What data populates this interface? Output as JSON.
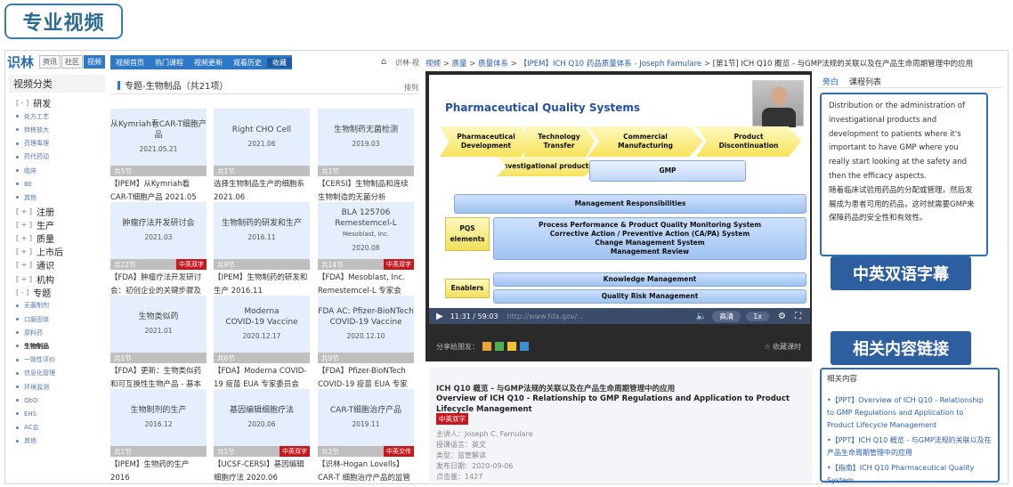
{
  "banner": "专业视频",
  "topbar": {
    "logo": "识林",
    "mini_tabs": [
      "资讯",
      "社区",
      "视频"
    ],
    "nav": [
      "视频首页",
      "热门课程",
      "视频更新",
      "观看历史",
      "收藏"
    ],
    "home_text": "识林-视"
  },
  "sidebar": {
    "title": "视频分类",
    "items": [
      {
        "kind": "main",
        "pm": "[ - ]",
        "label": "研发"
      },
      {
        "kind": "sub",
        "label": "处方工艺"
      },
      {
        "kind": "sub",
        "label": "转移放大"
      },
      {
        "kind": "sub",
        "label": "药理毒理"
      },
      {
        "kind": "sub",
        "label": "药代药动"
      },
      {
        "kind": "sub",
        "label": "临床"
      },
      {
        "kind": "sub",
        "label": "BE"
      },
      {
        "kind": "sub",
        "label": "其他"
      },
      {
        "kind": "main",
        "pm": "[ + ]",
        "label": "注册"
      },
      {
        "kind": "main",
        "pm": "[ + ]",
        "label": "生产"
      },
      {
        "kind": "main",
        "pm": "[ + ]",
        "label": "质量"
      },
      {
        "kind": "main",
        "pm": "[ + ]",
        "label": "上市后"
      },
      {
        "kind": "main",
        "pm": "[ + ]",
        "label": "通识"
      },
      {
        "kind": "main",
        "pm": "[ + ]",
        "label": "机构"
      },
      {
        "kind": "main",
        "pm": "[ - ]",
        "label": "专题"
      },
      {
        "kind": "sub",
        "label": "无菌制剂"
      },
      {
        "kind": "sub",
        "label": "口服固体"
      },
      {
        "kind": "sub",
        "label": "原料药"
      },
      {
        "kind": "sub",
        "label": "生物制品",
        "current": true
      },
      {
        "kind": "sub",
        "label": "一致性评价"
      },
      {
        "kind": "sub",
        "label": "信息化管理"
      },
      {
        "kind": "sub",
        "label": "环境监测"
      },
      {
        "kind": "sub",
        "label": "QbD"
      },
      {
        "kind": "sub",
        "label": "EHS"
      },
      {
        "kind": "sub",
        "label": "AC会"
      },
      {
        "kind": "sub",
        "label": "其他"
      }
    ]
  },
  "content": {
    "title": "专题-生物制品（共21项）",
    "sort": "排列"
  },
  "cards": [
    {
      "lines": [
        "从Kymriah看CAR-T细胞产品"
      ],
      "date": "2021.05.21",
      "count": "共5节",
      "tag": "",
      "desc": "【IPEM】从Kymriah看CAR-T细胞产品 2021.05"
    },
    {
      "lines": [
        "Right CHO Cell"
      ],
      "date": "2021.06",
      "count": "共1节",
      "tag": "",
      "desc": "选择生物制品生产的细胞系 2021.06"
    },
    {
      "lines": [
        "生物制药无菌检测"
      ],
      "date": "2019.03",
      "count": "共1节",
      "tag": "",
      "desc": "【CERSI】生物制品和连续生物制造的无菌分析 2019.03"
    },
    {
      "lines": [
        "肿瘤疗法开发研讨会"
      ],
      "date": "2021.03",
      "count": "共22节",
      "tag": "中英双字",
      "desc": "【FDA】肿瘤疗法开发研讨会：初创企业的关键步骤及"
    },
    {
      "lines": [
        "生物制药的研发和生产"
      ],
      "date": "2016.11",
      "count": "共9节",
      "tag": "",
      "desc": "【IPEM】生物制药的研发和生产 2016.11"
    },
    {
      "lines": [
        "BLA 125706",
        "Remestemcel-L"
      ],
      "small": "Mesoblast, Inc.",
      "date": "2020.08",
      "count": "共14节",
      "tag": "中英双字",
      "desc": "【FDA】Mesoblast, Inc. Remestemcel-L 专家会"
    },
    {
      "lines": [
        "生物类似药"
      ],
      "date": "2021.01",
      "count": "共1节",
      "tag": "",
      "desc": "【FDA】更新：生物类似药和可互换性生物产品 - 基本"
    },
    {
      "lines": [
        "Moderna",
        "COVID-19 Vaccine"
      ],
      "date": "2020.12.17",
      "count": "共6节",
      "tag": "",
      "desc": "【FDA】Moderna COVID-19 疫苗 EUA 专家委员会"
    },
    {
      "lines": [
        "FDA AC: Pfizer-BioNTech",
        "COVID-19 Vaccine"
      ],
      "date": "2020.12.10",
      "count": "共9节",
      "tag": "",
      "desc": "【FDA】Pfizer-BioNTech COVID-19 疫苗 EUA 专家委"
    },
    {
      "lines": [
        "生物制剂的生产"
      ],
      "date": "2016.12",
      "count": "共1节",
      "tag": "",
      "desc": "【IPEM】生物药的生产 2016"
    },
    {
      "lines": [
        "基因编辑细胞疗法"
      ],
      "date": "2020.06",
      "count": "共1节",
      "tag": "中英双字",
      "desc": "【UCSF-CERSI】基因编辑细胞疗法 2020.06"
    },
    {
      "lines": [
        "CAR-T细胞治疗产品"
      ],
      "date": "2019.11",
      "count": "共2节",
      "tag": "中英交传",
      "desc": "【识林-Hogan Lovells】CAR-T 细胞治疗产品的监管"
    }
  ],
  "breadcrumb": [
    "视频",
    "质量",
    "质量体系",
    "【IPEM】ICH Q10 药品质量体系 - Joseph Famulare",
    "[第1节] ICH Q10 概览 - 与GMP法规的关联以及在产品生命周期管理中的应用"
  ],
  "slide": {
    "title": "Pharmaceutical Quality Systems",
    "chevrons": [
      "Pharmaceutical\nDevelopment",
      "Technology\nTransfer",
      "Commercial\nManufacturing",
      "Product\nDiscontinuation"
    ],
    "investigational": "Investigational products",
    "gmp": "GMP",
    "mgmt_resp": "Management Responsibilities",
    "pqs_label": "PQS\nelements",
    "pqs_lines": "Process Performance & Product Quality Monitoring System\nCorrective Action / Preventive Action (CA/PA) System\nChange Management System\nManagement Review",
    "enablers": "Enablers",
    "knowledge": "Knowledge Management",
    "qrm": "Quality Risk Management"
  },
  "player": {
    "time": "11:31 / 59:03",
    "url": "http://www.fda.gov/...",
    "quality": "高清",
    "speed": "1x"
  },
  "share": {
    "label": "分享给朋友：",
    "fav": "收藏课时"
  },
  "side_tabs": [
    "旁白",
    "课程列表"
  ],
  "transcript": {
    "en": "Distribution or the administration of investigational products and development to patients where it's important to have GMP where you really start looking at the safety and then the efficacy aspects.",
    "zh": "随着临床试验用药品的分配或管理，然后发展成为患者可用的药品，这时就需要GMP来保障药品的安全性和有效性。"
  },
  "callouts": {
    "subtitle": "中英双语字幕",
    "links": "相关内容链接"
  },
  "detail": {
    "title_cn": "ICH Q10 概览 - 与GMP法规的关联以及在产品生命周期管理中的应用",
    "title_en": "Overview of ICH Q10 - Relationship to GMP Regulations and Application to Product Lifecycle Management",
    "tag": "中英双字",
    "speaker": "主讲人：Joseph C. Famulare",
    "lang": "授课语言：英文",
    "type": "类型：监管解读",
    "date": "发布日期：2020-09-06",
    "clicks": "点击量：1427"
  },
  "related": {
    "header": "相关内容",
    "items": [
      "•【PPT】Overview of ICH Q10 - Relationship to GMP Regulations and Application to Product Lifecycle Management",
      "•【PPT】ICH Q10 概览 - 与GMP法规的关联以及在产品生命周期管理中的应用",
      "•【指南】ICH Q10 Pharmaceutical Quality System"
    ]
  }
}
